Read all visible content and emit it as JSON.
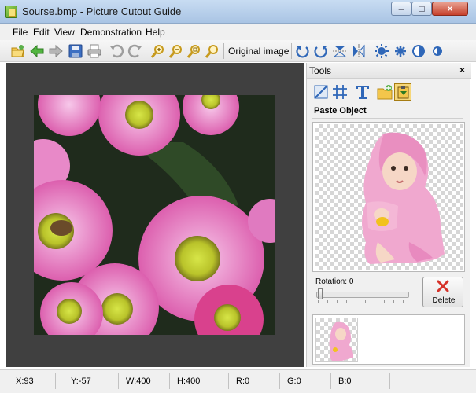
{
  "window": {
    "title": "Sourse.bmp - Picture Cutout Guide"
  },
  "menu": [
    "File",
    "Edit",
    "View",
    "Demonstration",
    "Help"
  ],
  "toolbar": {
    "icons": [
      "open-folder-icon",
      "back-arrow-icon",
      "forward-arrow-icon",
      "save-icon",
      "print-icon",
      "undo-icon",
      "redo-icon",
      "zoom-in-icon",
      "zoom-out-icon",
      "zoom-fit-icon",
      "zoom-actual-icon",
      "rotate-left-icon",
      "rotate-right-icon",
      "flip-vertical-icon",
      "flip-horizontal-icon",
      "brightness-icon",
      "gear-icon",
      "contrast-icon",
      "half-circle-icon"
    ],
    "original_image_label": "Original image"
  },
  "tools_panel": {
    "title": "Tools",
    "close_label": "×",
    "tool_icons": [
      "crop-icon",
      "grid-icon",
      "text-icon",
      "add-image-icon",
      "paste-object-icon"
    ],
    "section_title": "Paste Object",
    "rotation_label": "Rotation:",
    "rotation_value": "0",
    "delete_label": "Delete"
  },
  "status": {
    "x": "X:93",
    "y": "Y:-57",
    "w": "W:400",
    "h": "H:400",
    "r": "R:0",
    "g": "G:0",
    "b": "B:0"
  },
  "colors": {
    "title_bar": "#a9c4e4",
    "canvas_background": "#404040",
    "panel_background": "#f0f0f0",
    "accent_tool": "#f6d77a",
    "delete_red": "#d6332a"
  }
}
